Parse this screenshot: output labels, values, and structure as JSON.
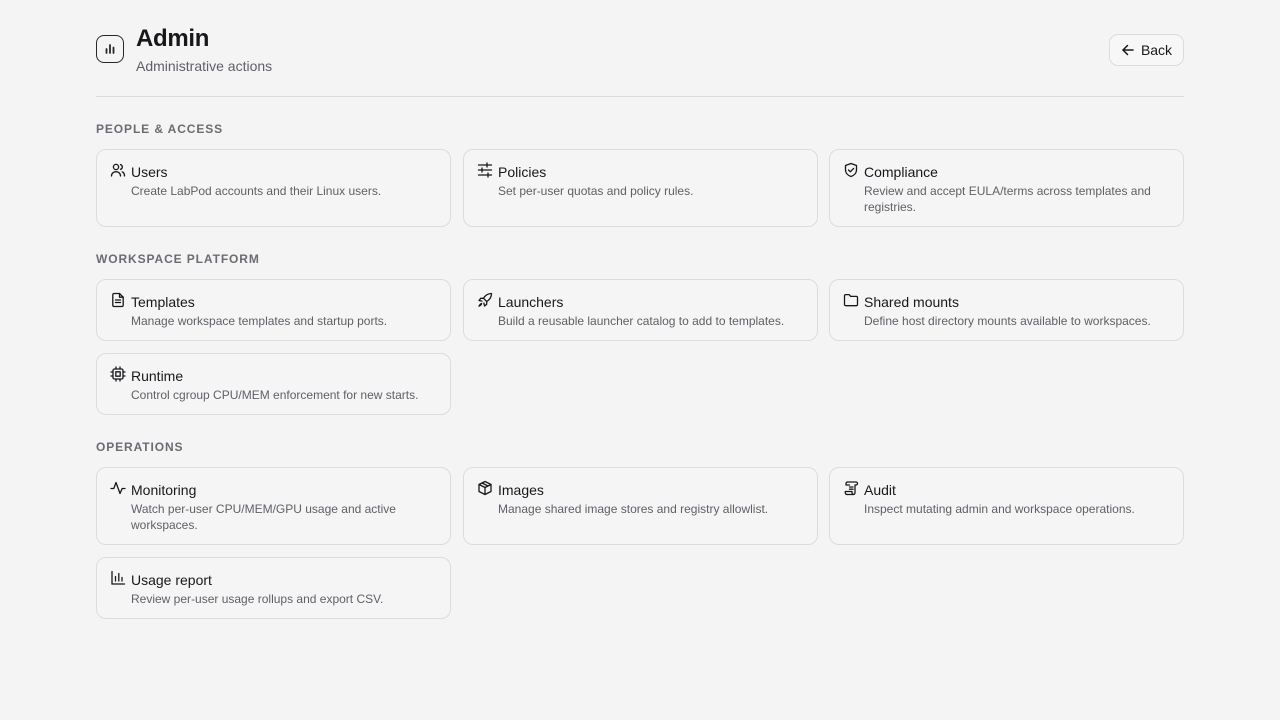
{
  "header": {
    "title": "Admin",
    "subtitle": "Administrative actions",
    "back_label": "Back"
  },
  "sections": [
    {
      "title": "PEOPLE & ACCESS",
      "cards": [
        {
          "title": "Users",
          "description": "Create LabPod accounts and their Linux users.",
          "icon": "users-icon"
        },
        {
          "title": "Policies",
          "description": "Set per-user quotas and policy rules.",
          "icon": "sliders-icon"
        },
        {
          "title": "Compliance",
          "description": "Review and accept EULA/terms across templates and registries.",
          "icon": "shield-check-icon"
        }
      ]
    },
    {
      "title": "WORKSPACE PLATFORM",
      "cards": [
        {
          "title": "Templates",
          "description": "Manage workspace templates and startup ports.",
          "icon": "file-text-icon"
        },
        {
          "title": "Launchers",
          "description": "Build a reusable launcher catalog to add to templates.",
          "icon": "rocket-icon"
        },
        {
          "title": "Shared mounts",
          "description": "Define host directory mounts available to workspaces.",
          "icon": "folder-icon"
        },
        {
          "title": "Runtime",
          "description": "Control cgroup CPU/MEM enforcement for new starts.",
          "icon": "cpu-icon"
        }
      ]
    },
    {
      "title": "OPERATIONS",
      "cards": [
        {
          "title": "Monitoring",
          "description": "Watch per-user CPU/MEM/GPU usage and active workspaces.",
          "icon": "activity-icon"
        },
        {
          "title": "Images",
          "description": "Manage shared image stores and registry allowlist.",
          "icon": "package-icon"
        },
        {
          "title": "Audit",
          "description": "Inspect mutating admin and workspace operations.",
          "icon": "scroll-icon"
        },
        {
          "title": "Usage report",
          "description": "Review per-user usage rollups and export CSV.",
          "icon": "bar-chart-icon"
        }
      ]
    }
  ]
}
